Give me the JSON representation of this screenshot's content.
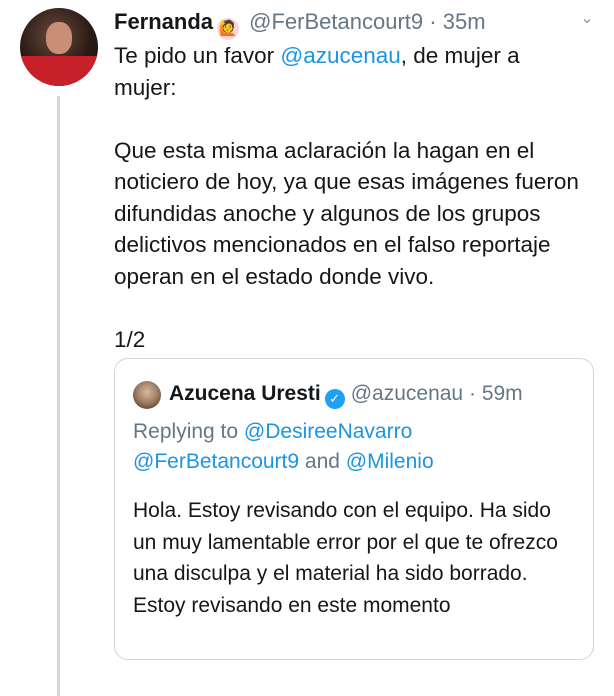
{
  "tweet": {
    "author_name": "Fernanda",
    "author_emoji": "🙋",
    "handle": "@FerBetancourt9",
    "separator": "·",
    "time": "35m",
    "line1_prefix": "Te pido un favor ",
    "line1_mention": "@azucenau",
    "line1_suffix": ", de mujer a mujer:",
    "paragraph2": "Que esta misma aclaración la hagan en el noticiero de hoy, ya que esas imágenes fueron difundidas anoche y algunos de los grupos delictivos mencionados en el falso reportaje operan en el estado donde vivo.",
    "paragraph3": "1/2"
  },
  "quoted_tweet": {
    "author_name": "Azucena Uresti",
    "verified_icon": "verified-badge-icon",
    "handle": "@azucenau",
    "separator": "·",
    "time": "59m",
    "replying_prefix": "Replying to ",
    "replying_mention1": "@DesireeNavarro",
    "replying_mention2": "@FerBetancourt9",
    "replying_and": " and ",
    "replying_mention3": "@Milenio",
    "text": "Hola. Estoy revisando con el equipo. Ha sido un muy lamentable error por el que te ofrezco una disculpa y el material ha sido borrado. Estoy revisando en este momento"
  },
  "colors": {
    "link": "#1b95e0",
    "muted": "#657786",
    "text": "#14171a",
    "border": "#ccd6dd",
    "verified": "#1da1f2"
  }
}
